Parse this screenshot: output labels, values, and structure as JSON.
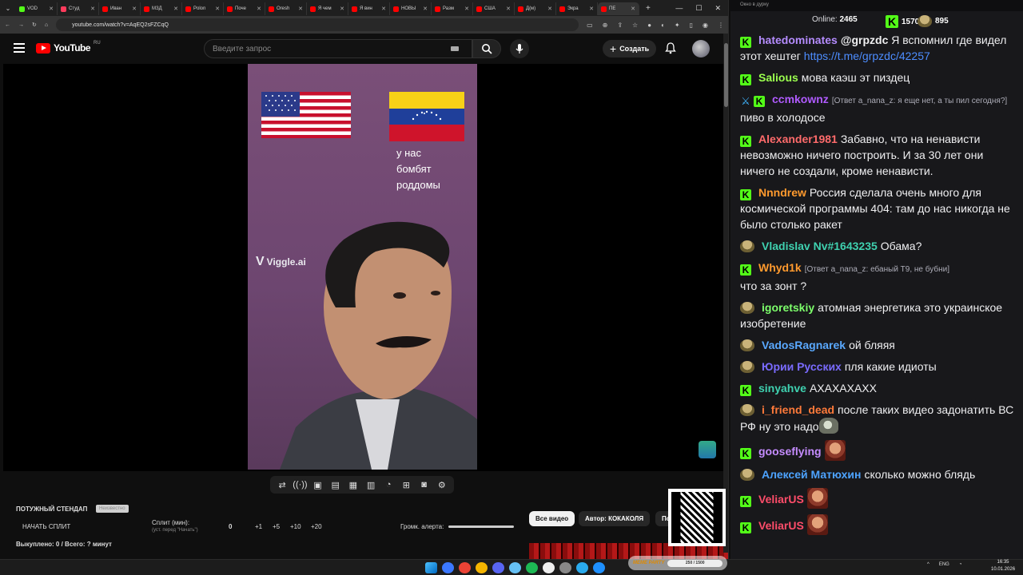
{
  "browser": {
    "tabs": [
      {
        "label": "VOD",
        "color": "#53fc18"
      },
      {
        "label": "Студ",
        "color": "#ff3b5c"
      },
      {
        "label": "Иван",
        "color": "#ff0000"
      },
      {
        "label": "МЗД",
        "color": "#ff0000"
      },
      {
        "label": "Polon",
        "color": "#ff0000"
      },
      {
        "label": "Поче",
        "color": "#ff0000"
      },
      {
        "label": "Oresh",
        "color": "#ff0000"
      },
      {
        "label": "Я чем",
        "color": "#ff0000"
      },
      {
        "label": "Я вин",
        "color": "#ff0000"
      },
      {
        "label": "НОВЫ",
        "color": "#ff0000"
      },
      {
        "label": "Разм",
        "color": "#ff0000"
      },
      {
        "label": "США",
        "color": "#ff0000"
      },
      {
        "label": "Д(м)",
        "color": "#ff0000"
      },
      {
        "label": "Экра",
        "color": "#ff0000"
      },
      {
        "label": "ПЕ",
        "color": "#ff0000"
      }
    ],
    "url": "youtube.com/watch?v=AqEQ2sFZCqQ"
  },
  "youtube": {
    "logo_text": "YouTube",
    "region": "RU",
    "search_placeholder": "Введите запрос",
    "create_label": "Создать"
  },
  "video": {
    "caption": "у нас\nбомбят\nроддомы",
    "watermark": "Viggle.ai"
  },
  "controls": [
    "⇄",
    "((·))",
    "▣",
    "▤",
    "▦",
    "▥",
    "◔",
    "⊞",
    "◙",
    "⚙"
  ],
  "bottom_panel": {
    "title": "ПОТУЖНЫЙ СТЕНДАП",
    "badge": "Неизвестно",
    "start_split": "НАЧАТЬ СПЛИТ",
    "split_label": "Сплит (мин):",
    "split_sub": "(уст. перед \"Начать\")",
    "split_value": "0",
    "steps": [
      "+1",
      "+5",
      "+10",
      "+20"
    ],
    "alert_label": "Громк. алерта:",
    "status": "Выкуплено: 0 / Всего: ? минут",
    "all_videos": "Все видео",
    "author": "Автор: КОКАКОЛЯ",
    "more": "По"
  },
  "chat": {
    "window_title": "Окно в дурку",
    "online_label": "Online:",
    "online_count": "2465",
    "points1": "1570",
    "points2": "895",
    "messages": [
      {
        "user": "hatedominates",
        "color": "#b58cff",
        "badges": [
          "k"
        ],
        "text_parts": [
          {
            "t": "@grpzdc",
            "b": true
          },
          {
            "t": " Я вспомнил где видел этот хештег "
          },
          {
            "t": "https://t.me/grpzdc/42257",
            "link": true
          }
        ]
      },
      {
        "user": "Salious",
        "color": "#9bff4f",
        "badges": [
          "k"
        ],
        "text_parts": [
          {
            "t": "мова каэш эт пиздец"
          }
        ]
      },
      {
        "user": "ccmkownz",
        "color": "#b05bff",
        "badges": [
          "sword",
          "k"
        ],
        "reply": "[Ответ a_nana_z: я еще нет, а ты пил сегодня?]",
        "text_parts": [
          {
            "t": "пиво в холодосе"
          }
        ]
      },
      {
        "user": "Alexander1981",
        "color": "#ff6b6b",
        "badges": [
          "k"
        ],
        "text_parts": [
          {
            "t": "Забавно, что на ненависти невозможно ничего построить. И за 30 лет они ничего не создали, кроме ненависти."
          }
        ]
      },
      {
        "user": "Nnndrew",
        "color": "#ff9a2e",
        "badges": [
          "k"
        ],
        "text_parts": [
          {
            "t": "Россия сделала очень много для космической программы 404: там до нас никогда не было столько ракет"
          }
        ]
      },
      {
        "user": "Vladislav Nv#1643235",
        "color": "#3fd1b0",
        "badges": [
          "face"
        ],
        "text_parts": [
          {
            "t": "Обама?"
          }
        ]
      },
      {
        "user": "Whyd1k",
        "color": "#ff9a2e",
        "badges": [
          "k"
        ],
        "reply": "[Ответ a_nana_z: ебаный Т9, не бубни]",
        "text_parts": [
          {
            "t": "что за зонт ?"
          }
        ]
      },
      {
        "user": "igoretskiy",
        "color": "#7dff6b",
        "badges": [
          "face"
        ],
        "text_parts": [
          {
            "t": "атомная энергетика это украинское изобретение"
          }
        ]
      },
      {
        "user": "VadosRagnarek",
        "color": "#5aa9ff",
        "badges": [
          "face"
        ],
        "text_parts": [
          {
            "t": "ой бляяя"
          }
        ]
      },
      {
        "user": "Юрии Русских",
        "color": "#7a6bff",
        "badges": [
          "face"
        ],
        "text_parts": [
          {
            "t": "пля какие идиоты"
          }
        ]
      },
      {
        "user": "sinyahve",
        "color": "#3fd1b0",
        "badges": [
          "k"
        ],
        "text_parts": [
          {
            "t": "АХАХАХАХХ"
          }
        ]
      },
      {
        "user": "i_friend_dead",
        "color": "#ff7a3a",
        "badges": [
          "face"
        ],
        "text_parts": [
          {
            "t": "после таких видео задонатить ВС РФ ну это надо"
          }
        ],
        "emote": "mush"
      },
      {
        "user": "gooseflying",
        "color": "#c58cff",
        "badges": [
          "k"
        ],
        "text_parts": [],
        "emote": "face"
      },
      {
        "user": "Алексей Матюхин",
        "color": "#4da3ff",
        "badges": [
          "face"
        ],
        "text_parts": [
          {
            "t": "сколько можно блядь"
          }
        ]
      },
      {
        "user": "VeliarUS",
        "color": "#ff4d6a",
        "badges": [
          "k"
        ],
        "text_parts": [],
        "emote": "face"
      },
      {
        "user": "VeliarUS",
        "color": "#ff4d6a",
        "badges": [
          "k"
        ],
        "text_parts": [],
        "emote": "face"
      }
    ]
  },
  "taskbar": {
    "meme_label": "MEME PARTY",
    "meme_progress": "250 / 1500",
    "lang": "ENG",
    "time": "16:35",
    "date": "10.01.2026",
    "icon_colors": [
      "#3b78ff",
      "#ea4335",
      "#f4b400",
      "#5865f2",
      "#66c0f4",
      "#1db954",
      "#eee",
      "#888",
      "#2aabee",
      "#1e90ff"
    ]
  }
}
